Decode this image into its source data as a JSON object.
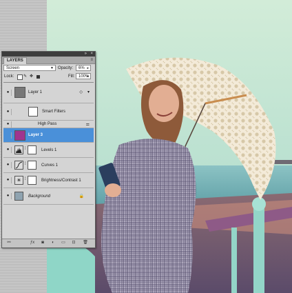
{
  "panel": {
    "title": "LAYERS",
    "blend_mode": "Screen",
    "opacity_label": "Opacity:",
    "opacity_value": "6%",
    "lock_label": "Lock:",
    "fill_label": "Fill:",
    "fill_value": "100%",
    "layers": [
      {
        "name": "Layer 1",
        "selected": false
      },
      {
        "name": "Smart Filters",
        "selected": false
      },
      {
        "name": "High Pass",
        "selected": false
      },
      {
        "name": "Layer 3",
        "selected": true
      },
      {
        "name": "Levels 1",
        "selected": false
      },
      {
        "name": "Curves 1",
        "selected": false
      },
      {
        "name": "Brightness/Contrast 1",
        "selected": false
      },
      {
        "name": "Background",
        "selected": false
      }
    ]
  },
  "colors": {
    "selected_row": "#4a90d9",
    "layer3_swatch": "#a0358f",
    "panel_bg": "#d4d4d4"
  }
}
